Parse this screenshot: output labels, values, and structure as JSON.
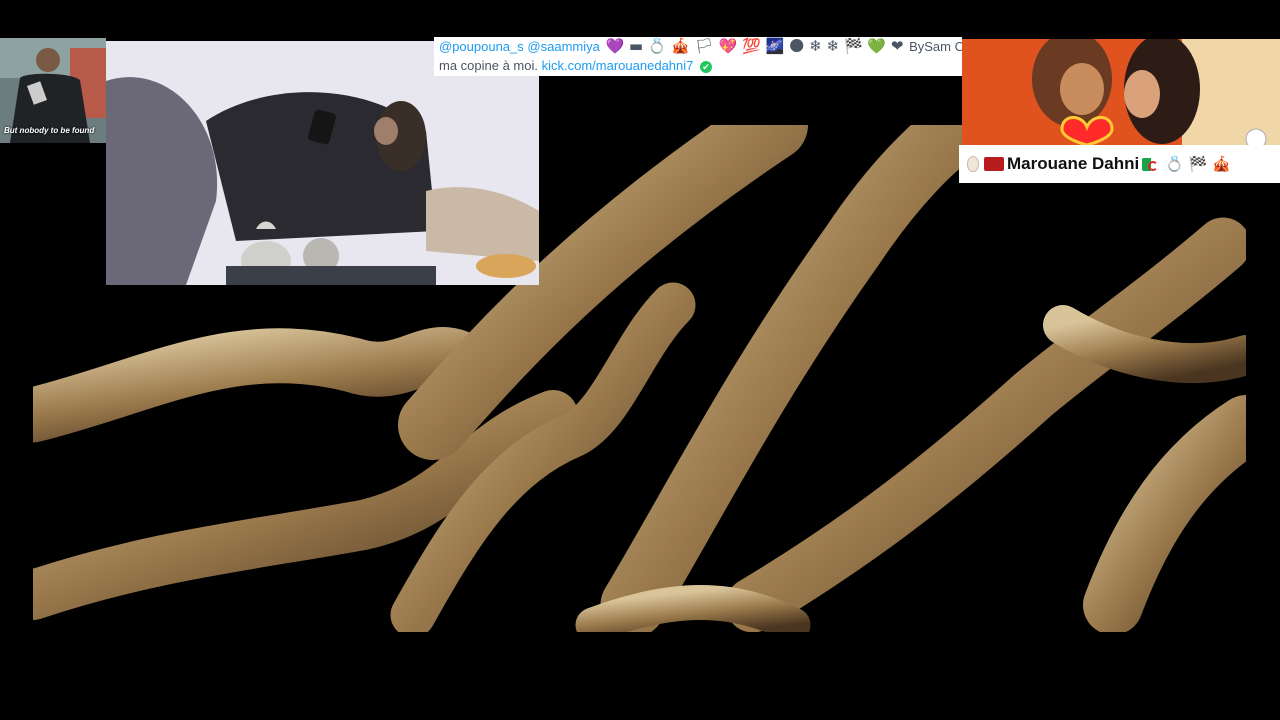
{
  "left_thumb": {
    "caption": "But nobody to be found"
  },
  "tweet": {
    "mention1": "@poupouna_s",
    "mention2": "@saammiya",
    "emoji_line": "💜 ▬ 💍 🎪 🏳 💖 💯 🌌 🌑 ❄ ❄ 🏁 💚 ❤",
    "suffix": "BySam C",
    "line2_text": "ma copine à moi.",
    "link": "kick.com/marouanedahni7",
    "verified_icon": "✔"
  },
  "name_banner": {
    "name": "Marouane Dahni",
    "trail_emojis": "💍 🏁 🎪"
  },
  "colors": {
    "background": "#000000",
    "link": "#1d9bf0",
    "banner_bg": "#ffffff"
  }
}
